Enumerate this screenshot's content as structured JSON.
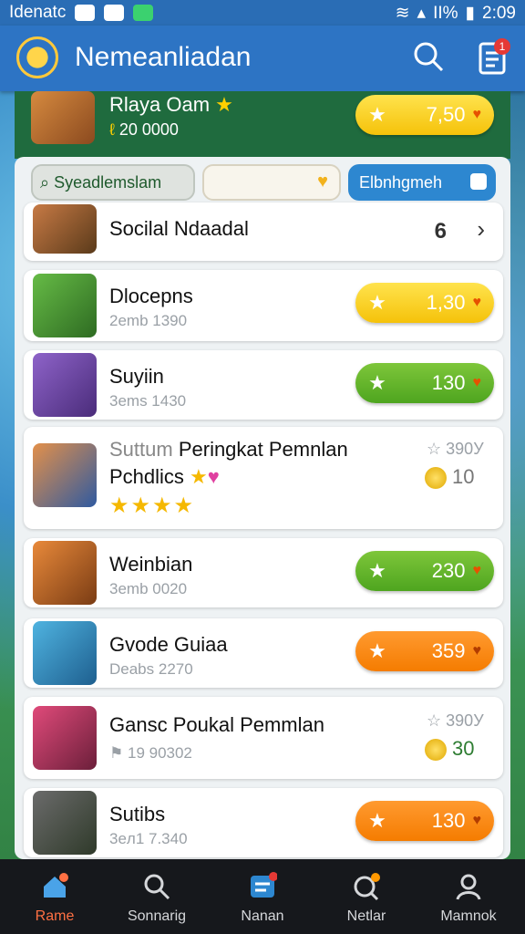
{
  "status_bar": {
    "left_text": "Idenatc",
    "battery": "ΙΙ%",
    "time": "2:09"
  },
  "app_bar": {
    "title": "Nemeanliadan",
    "notification_count": "1"
  },
  "featured": {
    "name": "Rlaya Oam",
    "score": "20 0000",
    "pill_value": "7,50"
  },
  "tabs": {
    "tab1": "Syeadlemslam",
    "tab3": "Elbnhgmeh"
  },
  "rows": [
    {
      "name": "Socilal Ndaadal",
      "count": "6"
    },
    {
      "name": "Dlocepns",
      "sub": "2emb 1390",
      "value": "1,30"
    },
    {
      "name": "Suyiin",
      "sub": "3ems 1430",
      "value": "130"
    },
    {
      "name_prefix": "Suttum",
      "name": "Peringkat Pemnlan",
      "name2": "Pchdlics",
      "stat": "390У",
      "coins": "10",
      "stars": "★★★★"
    },
    {
      "name": "Weinbian",
      "sub": "3emb 0020",
      "value": "230"
    },
    {
      "name": "Gvode Guiaa",
      "sub": "Deabs 2270",
      "value": "359"
    },
    {
      "name": "Gansc Poukal Pemmlan",
      "sub": "19 90302",
      "stat": "390У",
      "coins": "30"
    },
    {
      "name": "Sutibs",
      "sub": "3eл1 7.340",
      "value": "130"
    }
  ],
  "nav": [
    {
      "label": "Rame",
      "icon": "home-icon",
      "active": true
    },
    {
      "label": "Sonnarig",
      "icon": "search-icon"
    },
    {
      "label": "Nanan",
      "icon": "messages-icon"
    },
    {
      "label": "Netlar",
      "icon": "notifications-icon"
    },
    {
      "label": "Mamnok",
      "icon": "profile-icon"
    }
  ],
  "colors": {
    "appbar": "#2d74c4",
    "green_pill": "#5ab02a",
    "orange_pill": "#f57c00",
    "yellow_pill": "#f5c20a"
  }
}
